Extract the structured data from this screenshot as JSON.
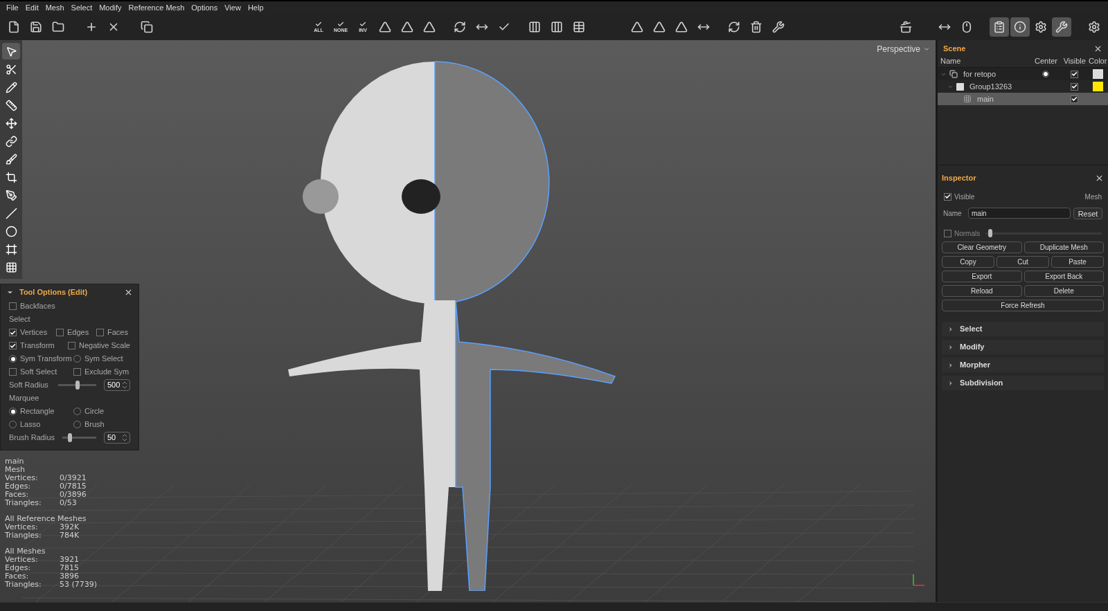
{
  "menu": [
    "File",
    "Edit",
    "Mesh",
    "Select",
    "Modify",
    "Reference Mesh",
    "Options",
    "View",
    "Help"
  ],
  "toolbar": {
    "select_labels": [
      "ALL",
      "NONE",
      "INV"
    ],
    "panel_toggles": [
      {
        "on": true
      },
      {
        "on": true
      },
      {
        "on": false
      },
      {
        "on": true
      }
    ]
  },
  "tools": [
    {
      "selected": true
    },
    {
      "selected": false
    },
    {
      "selected": false
    },
    {
      "selected": false
    },
    {
      "selected": false
    },
    {
      "selected": false
    },
    {
      "selected": false
    },
    {
      "selected": false
    },
    {
      "selected": false
    },
    {
      "selected": false
    },
    {
      "selected": false
    },
    {
      "selected": false
    },
    {
      "selected": false
    }
  ],
  "viewport": {
    "view_label": "Perspective"
  },
  "tool_options": {
    "title": "Tool Options (Edit)",
    "rows": [
      [
        {
          "kind": "check",
          "label": "Backfaces",
          "checked": false
        }
      ],
      [
        {
          "kind": "heading",
          "label": "Select"
        }
      ],
      [
        {
          "kind": "check",
          "label": "Vertices",
          "checked": true
        },
        {
          "kind": "check",
          "label": "Edges",
          "checked": false
        },
        {
          "kind": "check",
          "label": "Faces",
          "checked": false
        }
      ],
      [
        {
          "kind": "check",
          "label": "Transform",
          "checked": true
        },
        {
          "kind": "check",
          "label": "Negative Scale",
          "checked": false
        }
      ],
      [
        {
          "kind": "radio",
          "label": "Sym Transform",
          "selected": true
        },
        {
          "kind": "radio",
          "label": "Sym Select",
          "selected": false
        }
      ],
      [
        {
          "kind": "check",
          "label": "Soft Select",
          "checked": false
        },
        {
          "kind": "check",
          "label": "Exclude Sym",
          "checked": false
        }
      ],
      [
        {
          "kind": "slider",
          "label": "Soft Radius",
          "level": 0.5,
          "value": "500"
        }
      ],
      [
        {
          "kind": "heading",
          "label": "Marquee"
        }
      ],
      [
        {
          "kind": "radio",
          "label": "Rectangle",
          "selected": true
        },
        {
          "kind": "radio",
          "label": "Circle",
          "selected": false
        }
      ],
      [
        {
          "kind": "radio",
          "label": "Lasso",
          "selected": false
        },
        {
          "kind": "radio",
          "label": "Brush",
          "selected": false
        }
      ],
      [
        {
          "kind": "slider",
          "label": "Brush Radius",
          "level": 0.25,
          "value": "50"
        }
      ]
    ]
  },
  "stats": [
    [
      {
        "label": "main"
      },
      {
        "label": "Mesh"
      },
      {
        "label": "Vertices:",
        "value": "0/3921"
      },
      {
        "label": "Edges:",
        "value": "0/7815"
      },
      {
        "label": "Faces:",
        "value": "0/3896"
      },
      {
        "label": "Triangles:",
        "value": "0/53"
      }
    ],
    [
      {
        "label": "All Reference Meshes"
      },
      {
        "label": "Vertices:",
        "value": "392K"
      },
      {
        "label": "Triangles:",
        "value": "784K"
      }
    ],
    [
      {
        "label": "All Meshes"
      },
      {
        "label": "Vertices:",
        "value": "3921"
      },
      {
        "label": "Edges:",
        "value": "7815"
      },
      {
        "label": "Faces:",
        "value": "3896"
      },
      {
        "label": "Triangles:",
        "value": "53 (7739)"
      }
    ]
  ],
  "scene": {
    "title": "Scene",
    "columns": [
      "Name",
      "Center",
      "Visible",
      "Color"
    ],
    "rows": [
      {
        "name": "for retopo",
        "center": true,
        "visible": true,
        "color": "#dcdcdc",
        "expanded": true,
        "selected": false,
        "children": [
          {
            "name": "Group13263",
            "center": false,
            "visible": true,
            "color": "#ffe600",
            "expanded": true,
            "selected": false,
            "children": [
              {
                "name": "main",
                "center": false,
                "visible": true,
                "selected": true
              }
            ]
          }
        ]
      }
    ]
  },
  "inspector": {
    "title": "Inspector",
    "visible": {
      "label": "Visible",
      "checked": true
    },
    "type": "Mesh",
    "name": {
      "label": "Name",
      "value": "main"
    },
    "reset": "Reset",
    "normals": {
      "label": "Normals",
      "checked": false,
      "level": 0.02
    },
    "button_rows": [
      [
        "Clear Geometry",
        "Duplicate Mesh"
      ],
      [
        "Copy",
        "Cut",
        "Paste"
      ],
      [
        "Export",
        "Export Back"
      ],
      [
        "Reload",
        "Delete"
      ],
      [
        "Force Refresh"
      ]
    ],
    "sections": [
      {
        "label": "Select",
        "expanded": false
      },
      {
        "label": "Modify",
        "expanded": false
      },
      {
        "label": "Morpher",
        "expanded": false
      },
      {
        "label": "Subdivision",
        "expanded": false
      }
    ]
  }
}
